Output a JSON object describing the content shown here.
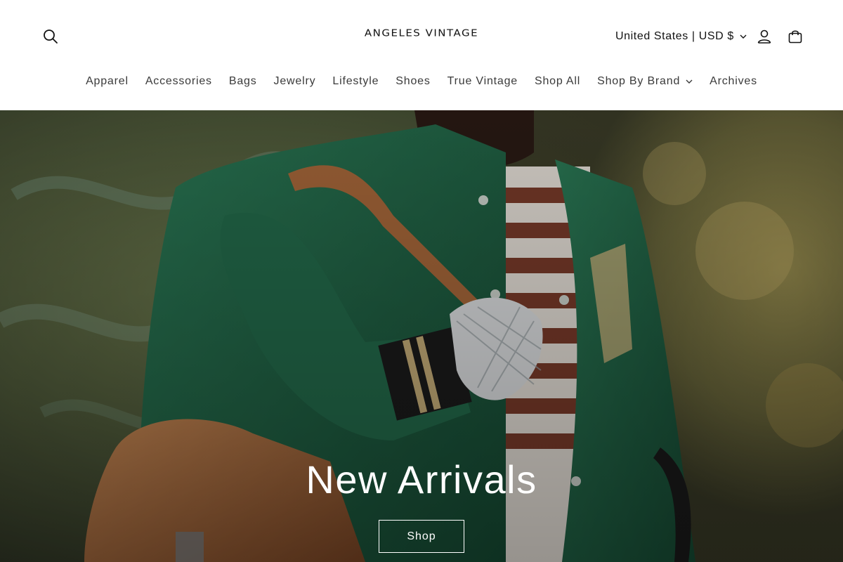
{
  "brand": {
    "name": "ANGELES VINTAGE"
  },
  "header": {
    "currency_label": "United States | USD $",
    "icons": [
      "search-icon",
      "account-icon",
      "cart-icon"
    ]
  },
  "nav": {
    "items": [
      {
        "label": "Apparel"
      },
      {
        "label": "Accessories"
      },
      {
        "label": "Bags"
      },
      {
        "label": "Jewelry"
      },
      {
        "label": "Lifestyle"
      },
      {
        "label": "Shoes"
      },
      {
        "label": "True Vintage"
      },
      {
        "label": "Shop All"
      },
      {
        "label": "Shop By Brand",
        "has_dropdown": true
      },
      {
        "label": "Archives"
      }
    ]
  },
  "hero": {
    "title": "New Arrivals",
    "button_label": "Shop"
  },
  "colors": {
    "text": "#121212",
    "nav_text": "#3a3a3a",
    "background": "#ffffff",
    "hero_text": "#ffffff",
    "jacket_green": "#1f6b4a",
    "bag_tan": "#b06a3a"
  }
}
